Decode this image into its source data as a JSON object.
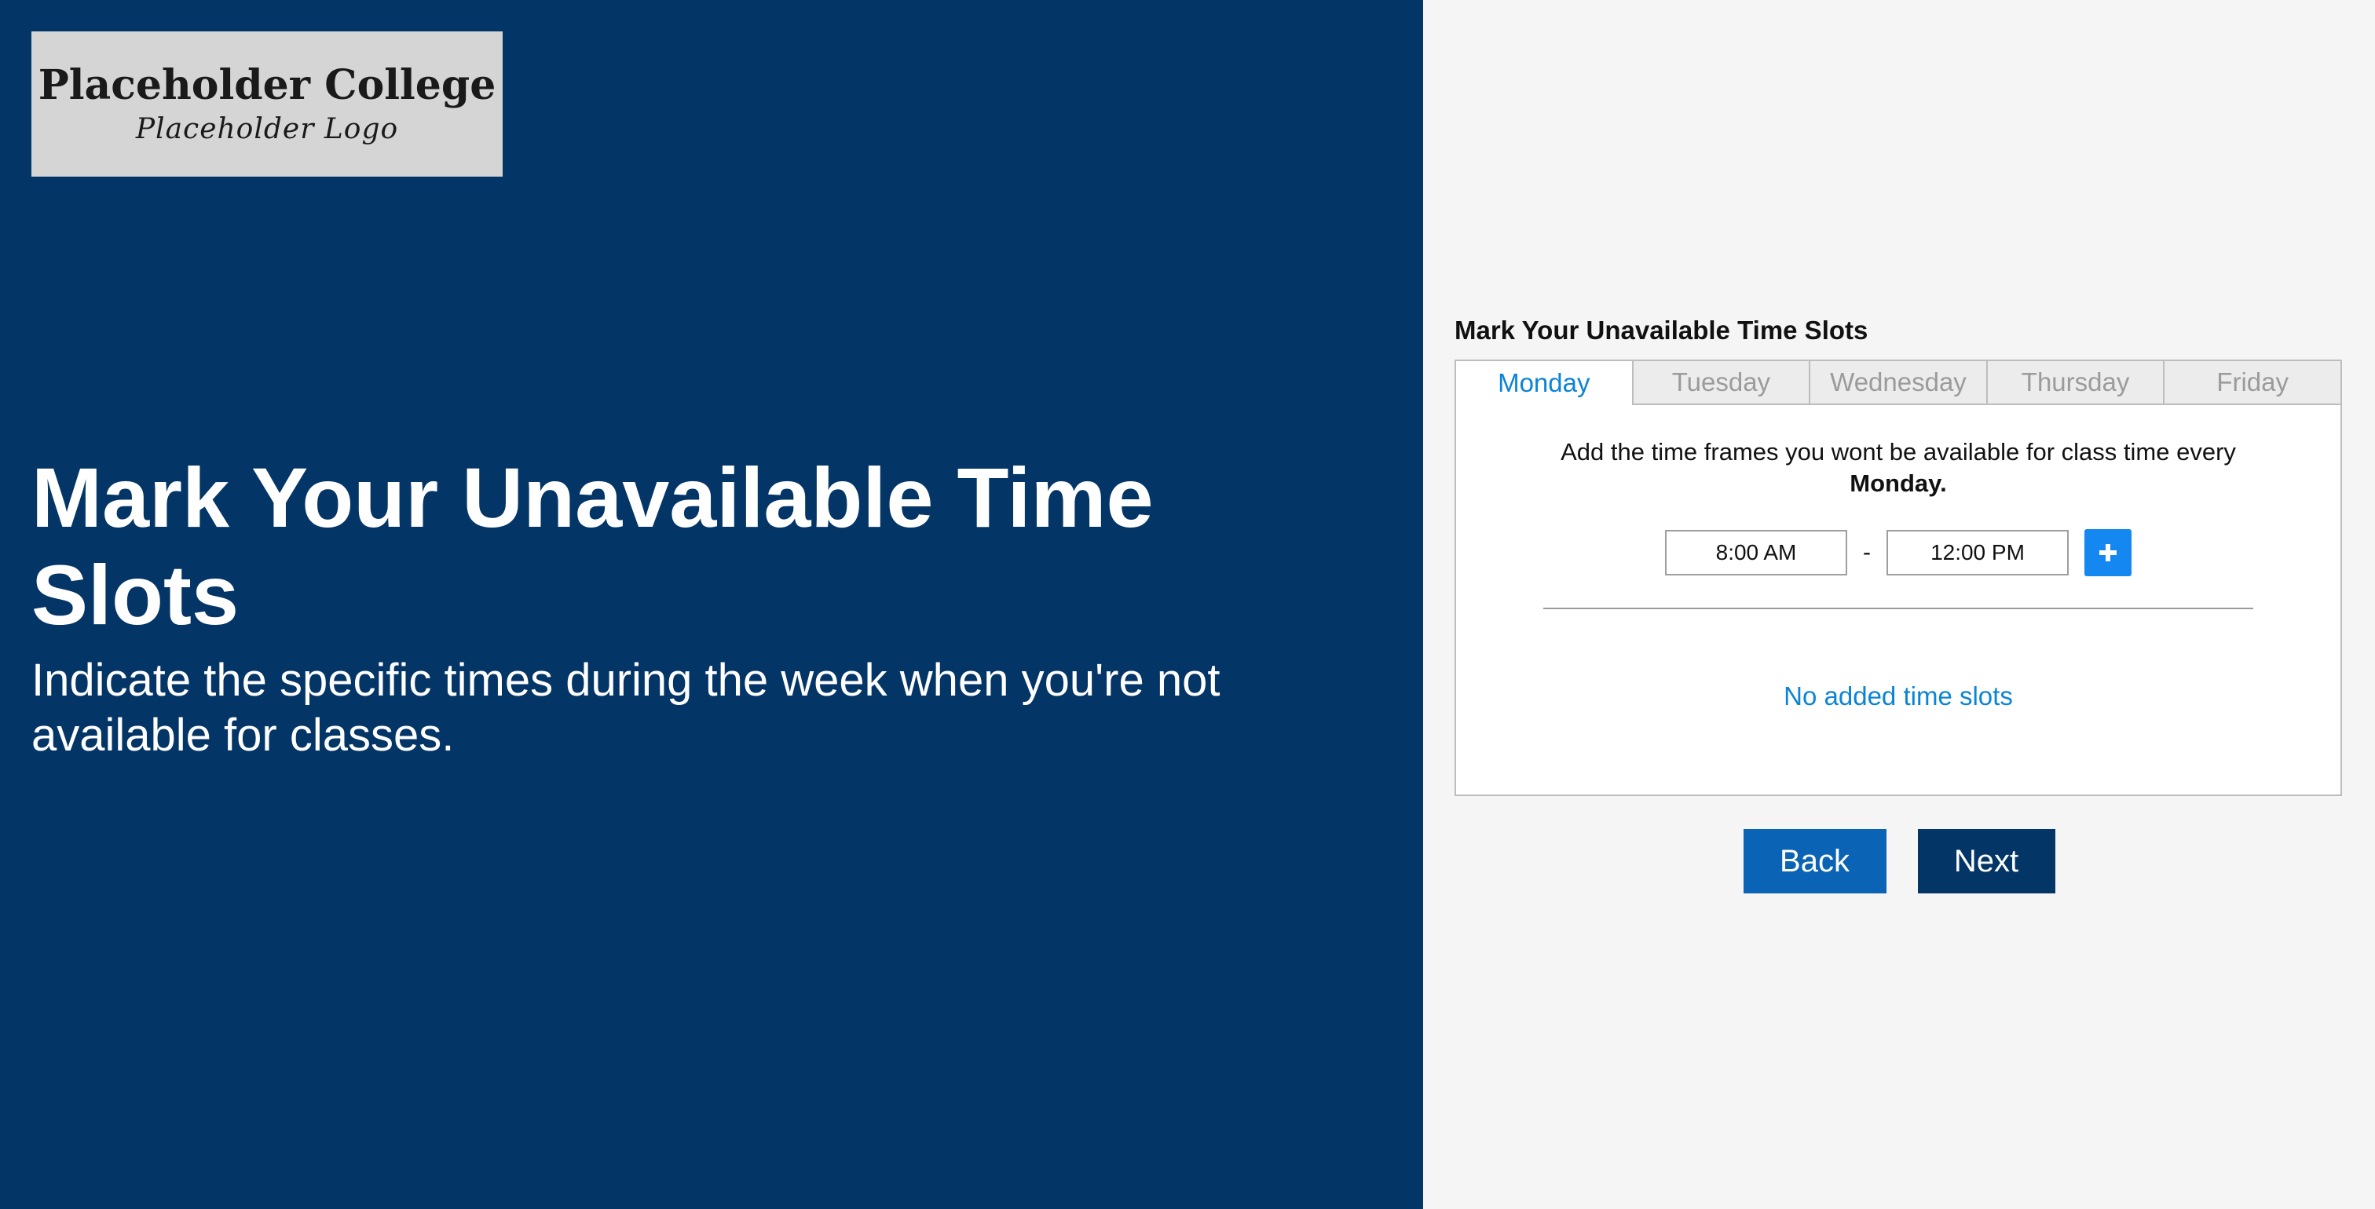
{
  "logo": {
    "title": "Placeholder College",
    "subtitle": "Placeholder Logo"
  },
  "hero": {
    "title": "Mark Your Unavailable Time Slots",
    "subtitle": "Indicate the specific times during the week when you're not available for classes."
  },
  "form": {
    "title": "Mark Your Unavailable Time Slots",
    "tabs": [
      {
        "label": "Monday",
        "active": true
      },
      {
        "label": "Tuesday",
        "active": false
      },
      {
        "label": "Wednesday",
        "active": false
      },
      {
        "label": "Thursday",
        "active": false
      },
      {
        "label": "Friday",
        "active": false
      }
    ],
    "instructions": "Add the time frames you wont be available for class time every",
    "selected_day": "Monday.",
    "start_time": "8:00 AM",
    "separator": "-",
    "end_time": "12:00 PM",
    "add_button_icon": "plus-icon",
    "empty_message": "No added time slots"
  },
  "buttons": {
    "back_label": "Back",
    "next_label": "Next"
  },
  "colors": {
    "left_bg": "#033566",
    "right_bg": "#f5f5f5",
    "accent": "#0b84d6",
    "add_button": "#1488f0",
    "back_button": "#0a63b5",
    "next_button": "#033566"
  }
}
